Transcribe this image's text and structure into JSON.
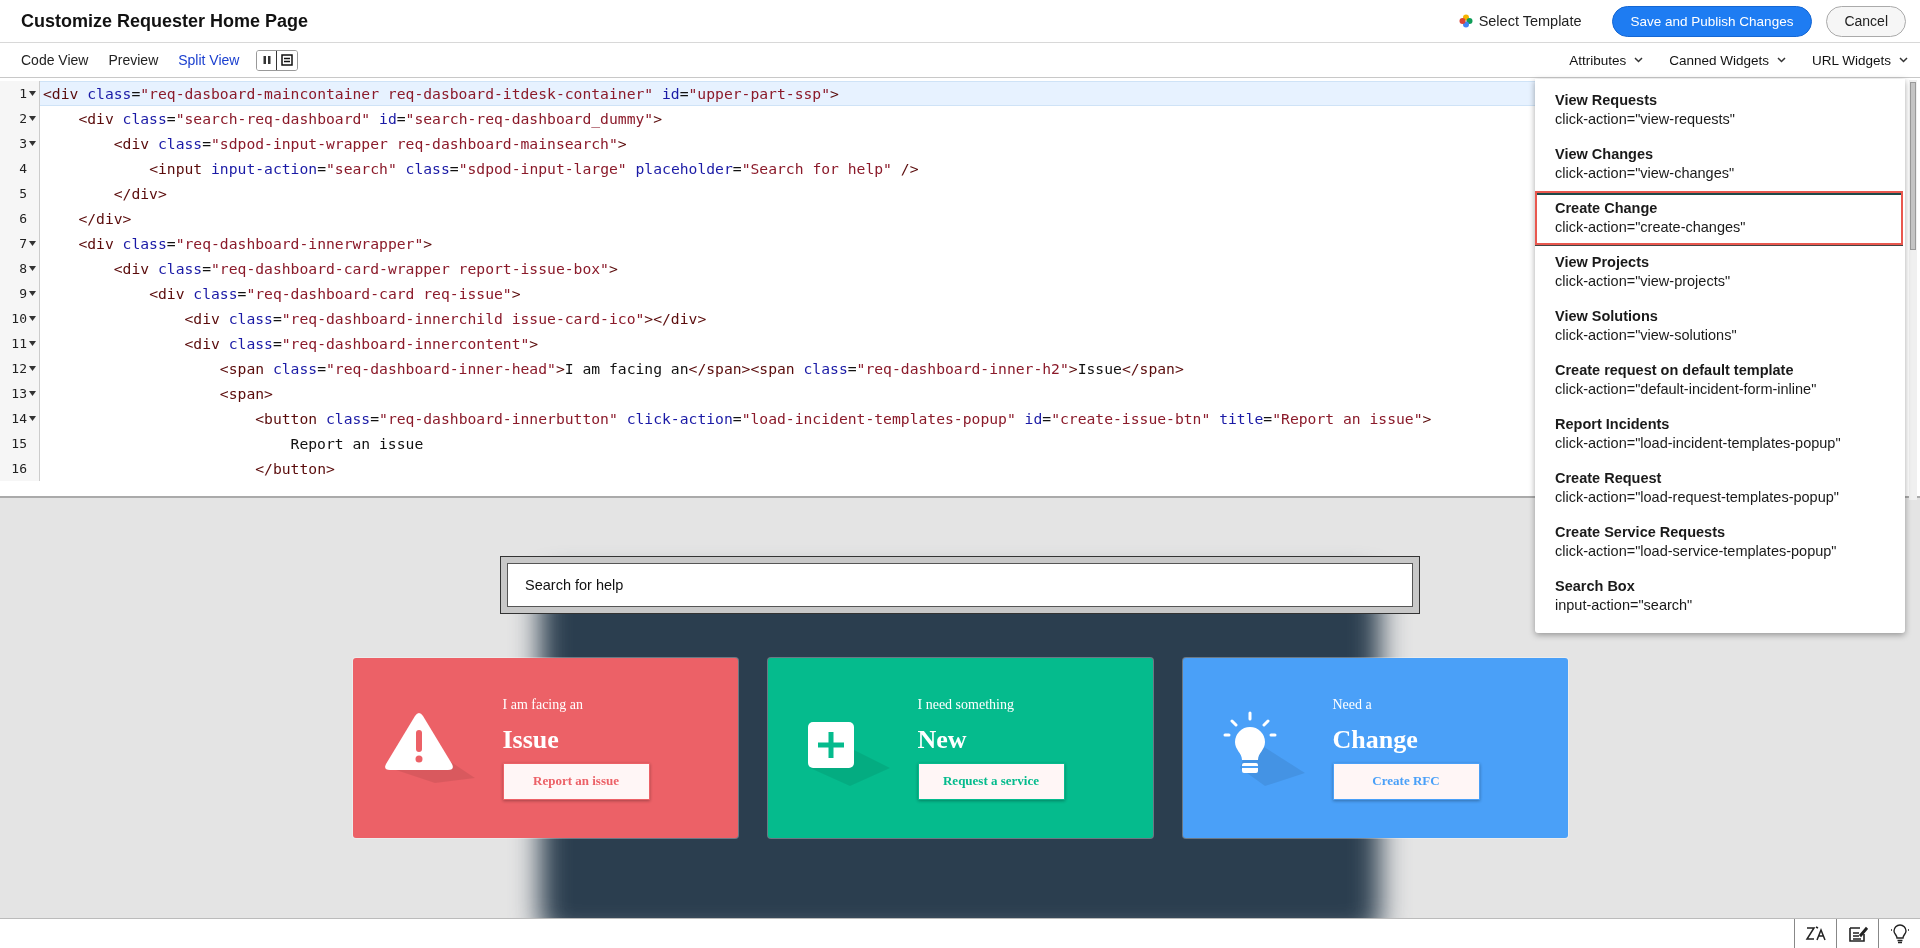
{
  "window": {
    "title": "Customize Requester Home Page"
  },
  "header_actions": {
    "select_template": "Select Template",
    "primary": "Save and Publish Changes",
    "secondary": "Cancel"
  },
  "view_tabs": [
    {
      "label": "Code View",
      "selected": false
    },
    {
      "label": "Preview",
      "selected": false
    },
    {
      "label": "Split View",
      "selected": true
    }
  ],
  "layout_toggles": [
    {
      "kind": "columns",
      "selected": false
    },
    {
      "kind": "rows",
      "selected": true
    }
  ],
  "widget_menus": [
    {
      "label": "Attributes"
    },
    {
      "label": "Canned Widgets"
    },
    {
      "label": "URL Widgets"
    }
  ],
  "code_lines": [
    {
      "number": "1",
      "foldable": true,
      "active": true,
      "text": "<div class=\"req-dasboard-maincontainer req-dasboard-itdesk-container\" id=\"upper-part-ssp\">"
    },
    {
      "number": "2",
      "foldable": true,
      "active": false,
      "text": "    <div class=\"search-req-dashboard\" id=\"search-req-dashboard_dummy\">"
    },
    {
      "number": "3",
      "foldable": true,
      "active": false,
      "text": "        <div class=\"sdpod-input-wrapper req-dashboard-mainsearch\">"
    },
    {
      "number": "4",
      "foldable": false,
      "active": false,
      "text": "            <input input-action=\"search\" class=\"sdpod-input-large\" placeholder=\"Search for help\" />"
    },
    {
      "number": "5",
      "foldable": false,
      "active": false,
      "text": "        </div>"
    },
    {
      "number": "6",
      "foldable": false,
      "active": false,
      "text": "    </div>"
    },
    {
      "number": "7",
      "foldable": true,
      "active": false,
      "text": "    <div class=\"req-dashboard-innerwrapper\">"
    },
    {
      "number": "8",
      "foldable": true,
      "active": false,
      "text": "        <div class=\"req-dashboard-card-wrapper report-issue-box\">"
    },
    {
      "number": "9",
      "foldable": true,
      "active": false,
      "text": "            <div class=\"req-dashboard-card req-issue\">"
    },
    {
      "number": "10",
      "foldable": true,
      "active": false,
      "text": "                <div class=\"req-dashboard-innerchild issue-card-ico\"></div>"
    },
    {
      "number": "11",
      "foldable": true,
      "active": false,
      "text": "                <div class=\"req-dashboard-innercontent\">"
    },
    {
      "number": "12",
      "foldable": true,
      "active": false,
      "text": "                    <span class=\"req-dashboard-inner-head\">I am facing an</span><span class=\"req-dashboard-inner-h2\">Issue</span>"
    },
    {
      "number": "13",
      "foldable": true,
      "active": false,
      "text": "                    <span>"
    },
    {
      "number": "14",
      "foldable": true,
      "active": false,
      "text": "                        <button class=\"req-dashboard-innerbutton\" click-action=\"load-incident-templates-popup\" id=\"create-issue-btn\" title=\"Report an issue\">"
    },
    {
      "number": "15",
      "foldable": false,
      "active": false,
      "text": "                            Report an issue"
    },
    {
      "number": "16",
      "foldable": false,
      "active": false,
      "text": "                        </button>"
    }
  ],
  "attributes_menu": [
    {
      "title": "View Requests",
      "code": "click-action=\"view-requests\"",
      "highlighted": false
    },
    {
      "title": "View Changes",
      "code": "click-action=\"view-changes\"",
      "highlighted": false
    },
    {
      "title": "Create Change",
      "code": "click-action=\"create-changes\"",
      "highlighted": true
    },
    {
      "title": "View Projects",
      "code": "click-action=\"view-projects\"",
      "highlighted": false
    },
    {
      "title": "View Solutions",
      "code": "click-action=\"view-solutions\"",
      "highlighted": false
    },
    {
      "title": "Create request on default template",
      "code": "click-action=\"default-incident-form-inline\"",
      "highlighted": false
    },
    {
      "title": "Report Incidents",
      "code": "click-action=\"load-incident-templates-popup\"",
      "highlighted": false
    },
    {
      "title": "Create Request",
      "code": "click-action=\"load-request-templates-popup\"",
      "highlighted": false
    },
    {
      "title": "Create Service Requests",
      "code": "click-action=\"load-service-templates-popup\"",
      "highlighted": false
    },
    {
      "title": "Search Box",
      "code": "input-action=\"search\"",
      "highlighted": false
    }
  ],
  "preview": {
    "search": {
      "placeholder": "Search for help"
    },
    "cards": [
      {
        "kind": "issue",
        "color": "#ec6167",
        "subtitle": "I am facing an",
        "title": "Issue",
        "button": "Report an issue"
      },
      {
        "kind": "service",
        "color": "#05bb8d",
        "subtitle": "I need something",
        "title": "New",
        "button": "Request a service"
      },
      {
        "kind": "change",
        "color": "#4aa0f8",
        "subtitle": "Need a",
        "title": "Change",
        "button": "Create RFC"
      }
    ]
  }
}
